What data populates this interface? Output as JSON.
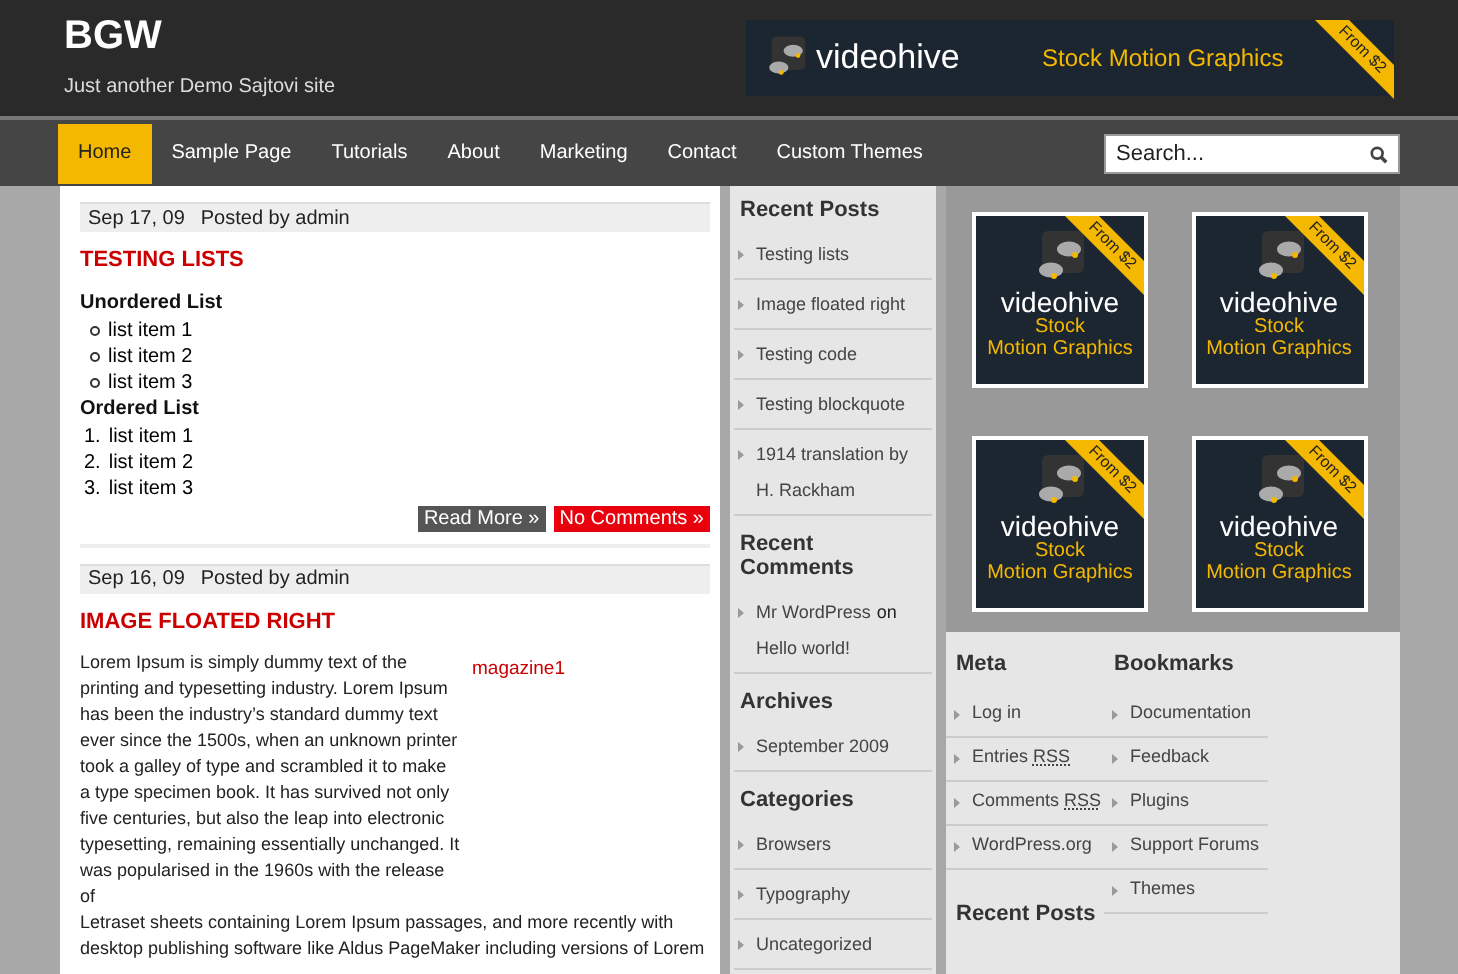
{
  "site": {
    "title": "BGW",
    "tagline": "Just another Demo Sajtovi site"
  },
  "header_ad": {
    "brand": "videohive",
    "tagline": "Stock Motion Graphics",
    "badge": "From $2"
  },
  "nav": {
    "items": [
      {
        "label": "Home",
        "selected": true
      },
      {
        "label": "Sample Page",
        "selected": false
      },
      {
        "label": "Tutorials",
        "selected": false
      },
      {
        "label": "About",
        "selected": false
      },
      {
        "label": "Marketing",
        "selected": false
      },
      {
        "label": "Contact",
        "selected": false
      },
      {
        "label": "Custom Themes",
        "selected": false
      }
    ],
    "search": {
      "placeholder": "Search..."
    }
  },
  "posts": [
    {
      "date": "Sep 17, 09",
      "author": "Posted by admin",
      "title": "TESTING LISTS",
      "blocks": [
        {
          "kind": "heading",
          "text": "Unordered List"
        },
        {
          "kind": "ul",
          "items": [
            "list item 1",
            "list item 2",
            "list item 3"
          ]
        },
        {
          "kind": "heading",
          "text": "Ordered List"
        },
        {
          "kind": "ol",
          "items": [
            {
              "marker": "1.",
              "text": "list item 1"
            },
            {
              "marker": "2.",
              "text": "list item 2"
            },
            {
              "marker": "3.",
              "text": "list item 3"
            }
          ]
        }
      ],
      "buttons": [
        {
          "label": "Read More »",
          "kind": "more"
        },
        {
          "label": "No Comments »",
          "kind": "comments"
        }
      ]
    },
    {
      "date": "Sep 16, 09",
      "author": "Posted by admin",
      "title": "IMAGE FLOATED RIGHT",
      "blocks": [
        {
          "kind": "float_image",
          "caption": "magazine1",
          "text_beside": "Lorem Ipsum is simply dummy text of the printing and typesetting industry. Lorem Ipsum has been the industry’s standard dummy text ever since the 1500s, when an unknown printer took a galley of type and scrambled it to make a type specimen book. It has survived not only five centuries, but also the leap into electronic typesetting, remaining essentially unchanged. It was popularised in the 1960s with the release of",
          "text_below": "Letraset sheets containing Lorem Ipsum passages, and more recently with desktop publishing software like Aldus PageMaker including versions of Lorem"
        }
      ]
    }
  ],
  "sidebar": [
    {
      "title": "Recent Posts",
      "items": [
        {
          "text": "Testing lists"
        },
        {
          "text": "Image floated right"
        },
        {
          "text": "Testing code"
        },
        {
          "text": "Testing blockquote"
        },
        {
          "text": "1914 translation by H. Rackham"
        }
      ]
    },
    {
      "title": "Recent Comments",
      "items": [
        {
          "author": "Mr WordPress",
          "connector": "on",
          "post": "Hello world!"
        }
      ]
    },
    {
      "title": "Archives",
      "items": [
        {
          "text": "September 2009"
        }
      ]
    },
    {
      "title": "Categories",
      "items": [
        {
          "text": "Browsers"
        },
        {
          "text": "Typography"
        },
        {
          "text": "Uncategorized"
        }
      ]
    }
  ],
  "ads": [
    {
      "brand": "videohive",
      "line1": "Stock",
      "line2": "Motion Graphics",
      "badge": "From $2"
    },
    {
      "brand": "videohive",
      "line1": "Stock",
      "line2": "Motion Graphics",
      "badge": "From $2"
    },
    {
      "brand": "videohive",
      "line1": "Stock",
      "line2": "Motion Graphics",
      "badge": "From $2"
    },
    {
      "brand": "videohive",
      "line1": "Stock",
      "line2": "Motion Graphics",
      "badge": "From $2"
    }
  ],
  "meta": {
    "title": "Meta",
    "items": [
      {
        "text": "Log in"
      },
      {
        "text": "Entries",
        "abbr": "RSS"
      },
      {
        "text": "Comments",
        "abbr": "RSS"
      },
      {
        "text": "WordPress.org"
      }
    ]
  },
  "bookmarks": {
    "title": "Bookmarks",
    "items": [
      {
        "text": "Documentation"
      },
      {
        "text": "Feedback"
      },
      {
        "text": "Plugins"
      },
      {
        "text": "Support Forums"
      },
      {
        "text": "Themes"
      }
    ]
  },
  "recent_posts_2": {
    "title": "Recent Posts"
  }
}
